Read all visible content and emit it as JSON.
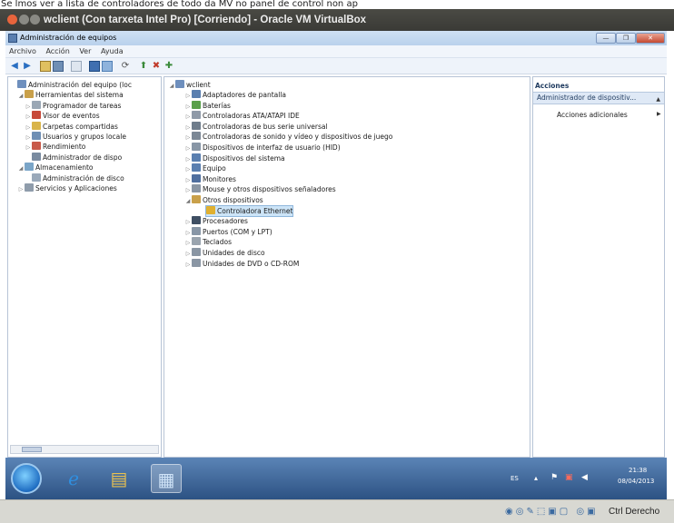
{
  "caption": "Se lmos ver a lista de controladores de todo da MV no panel de control non ap",
  "vbox": {
    "title": "wclient (Con tarxeta Intel Pro) [Corriendo] - Oracle VM VirtualBox"
  },
  "window": {
    "title": "Administración de equipos",
    "controls": {
      "minimize": "—",
      "maximize": "❐",
      "close": "✕"
    }
  },
  "menu": [
    "Archivo",
    "Acción",
    "Ver",
    "Ayuda"
  ],
  "navigation": {
    "items": [
      {
        "label": "Administración del equipo (loc",
        "level": 0,
        "tw": "",
        "icon": "computer-management-icon",
        "color": "#6e8fbd"
      },
      {
        "label": "Herramientas del sistema",
        "level": 1,
        "tw": "◢",
        "icon": "system-tools-icon",
        "color": "#c9a04a"
      },
      {
        "label": "Programador de tareas",
        "level": 2,
        "tw": "▷",
        "icon": "clock-icon",
        "color": "#9aa7b5"
      },
      {
        "label": "Visor de eventos",
        "level": 2,
        "tw": "▷",
        "icon": "event-viewer-icon",
        "color": "#c74a3a"
      },
      {
        "label": "Carpetas compartidas",
        "level": 2,
        "tw": "▷",
        "icon": "shared-folder-icon",
        "color": "#d9b44a"
      },
      {
        "label": "Usuarios y grupos locale",
        "level": 2,
        "tw": "▷",
        "icon": "users-icon",
        "color": "#6f8fb5"
      },
      {
        "label": "Rendimiento",
        "level": 2,
        "tw": "▷",
        "icon": "performance-icon",
        "color": "#c85a4a"
      },
      {
        "label": "Administrador de dispo",
        "level": 2,
        "tw": "",
        "icon": "device-manager-icon",
        "color": "#7a8ba0"
      },
      {
        "label": "Almacenamiento",
        "level": 1,
        "tw": "◢",
        "icon": "storage-icon",
        "color": "#7aa5c8"
      },
      {
        "label": "Administración de disco",
        "level": 2,
        "tw": "",
        "icon": "disk-management-icon",
        "color": "#9aa9ba"
      },
      {
        "label": "Servicios y Aplicaciones",
        "level": 1,
        "tw": "▷",
        "icon": "services-icon",
        "color": "#8f9cab"
      }
    ]
  },
  "devices": {
    "root": "wclient",
    "items": [
      {
        "label": "Adaptadores de pantalla",
        "icon": "display-adapter-icon",
        "color": "#5a7fb0"
      },
      {
        "label": "Baterías",
        "icon": "battery-icon",
        "color": "#5aa04a"
      },
      {
        "label": "Controladoras ATA/ATAPI IDE",
        "icon": "ide-controller-icon",
        "color": "#8f9aa8"
      },
      {
        "label": "Controladoras de bus serie universal",
        "icon": "usb-icon",
        "color": "#6f7d8c"
      },
      {
        "label": "Controladoras de sonido y vídeo y dispositivos de juego",
        "icon": "sound-icon",
        "color": "#7c8896"
      },
      {
        "label": "Dispositivos de interfaz de usuario (HID)",
        "icon": "hid-icon",
        "color": "#8896a6"
      },
      {
        "label": "Dispositivos del sistema",
        "icon": "system-device-icon",
        "color": "#5a7fb0"
      },
      {
        "label": "Equipo",
        "icon": "computer-icon",
        "color": "#5a7fb0"
      },
      {
        "label": "Monitores",
        "icon": "monitor-icon",
        "color": "#4f6f9f"
      },
      {
        "label": "Mouse y otros dispositivos señaladores",
        "icon": "mouse-icon",
        "color": "#8a96a4"
      },
      {
        "label": "Otros dispositivos",
        "icon": "other-devices-icon",
        "color": "#c9a04a"
      },
      {
        "label": "Controladora Ethernet",
        "icon": "warning-device-icon",
        "color": "#e0b030"
      },
      {
        "label": "Procesadores",
        "icon": "processor-icon",
        "color": "#3f4f63"
      },
      {
        "label": "Puertos (COM y LPT)",
        "icon": "port-icon",
        "color": "#8896a6"
      },
      {
        "label": "Teclados",
        "icon": "keyboard-icon",
        "color": "#9aa4ae"
      },
      {
        "label": "Unidades de disco",
        "icon": "disk-drive-icon",
        "color": "#8a96a4"
      },
      {
        "label": "Unidades de DVD o CD-ROM",
        "icon": "dvd-icon",
        "color": "#8a96a4"
      }
    ]
  },
  "actions": {
    "header": "Acciones",
    "selected": "Administrador de dispositiv...",
    "more": "Acciones adicionales"
  },
  "taskbar": {
    "language": "ES",
    "time": "21:38",
    "date": "08/04/2013"
  },
  "statusbar": {
    "host_key": "Ctrl Derecho"
  }
}
